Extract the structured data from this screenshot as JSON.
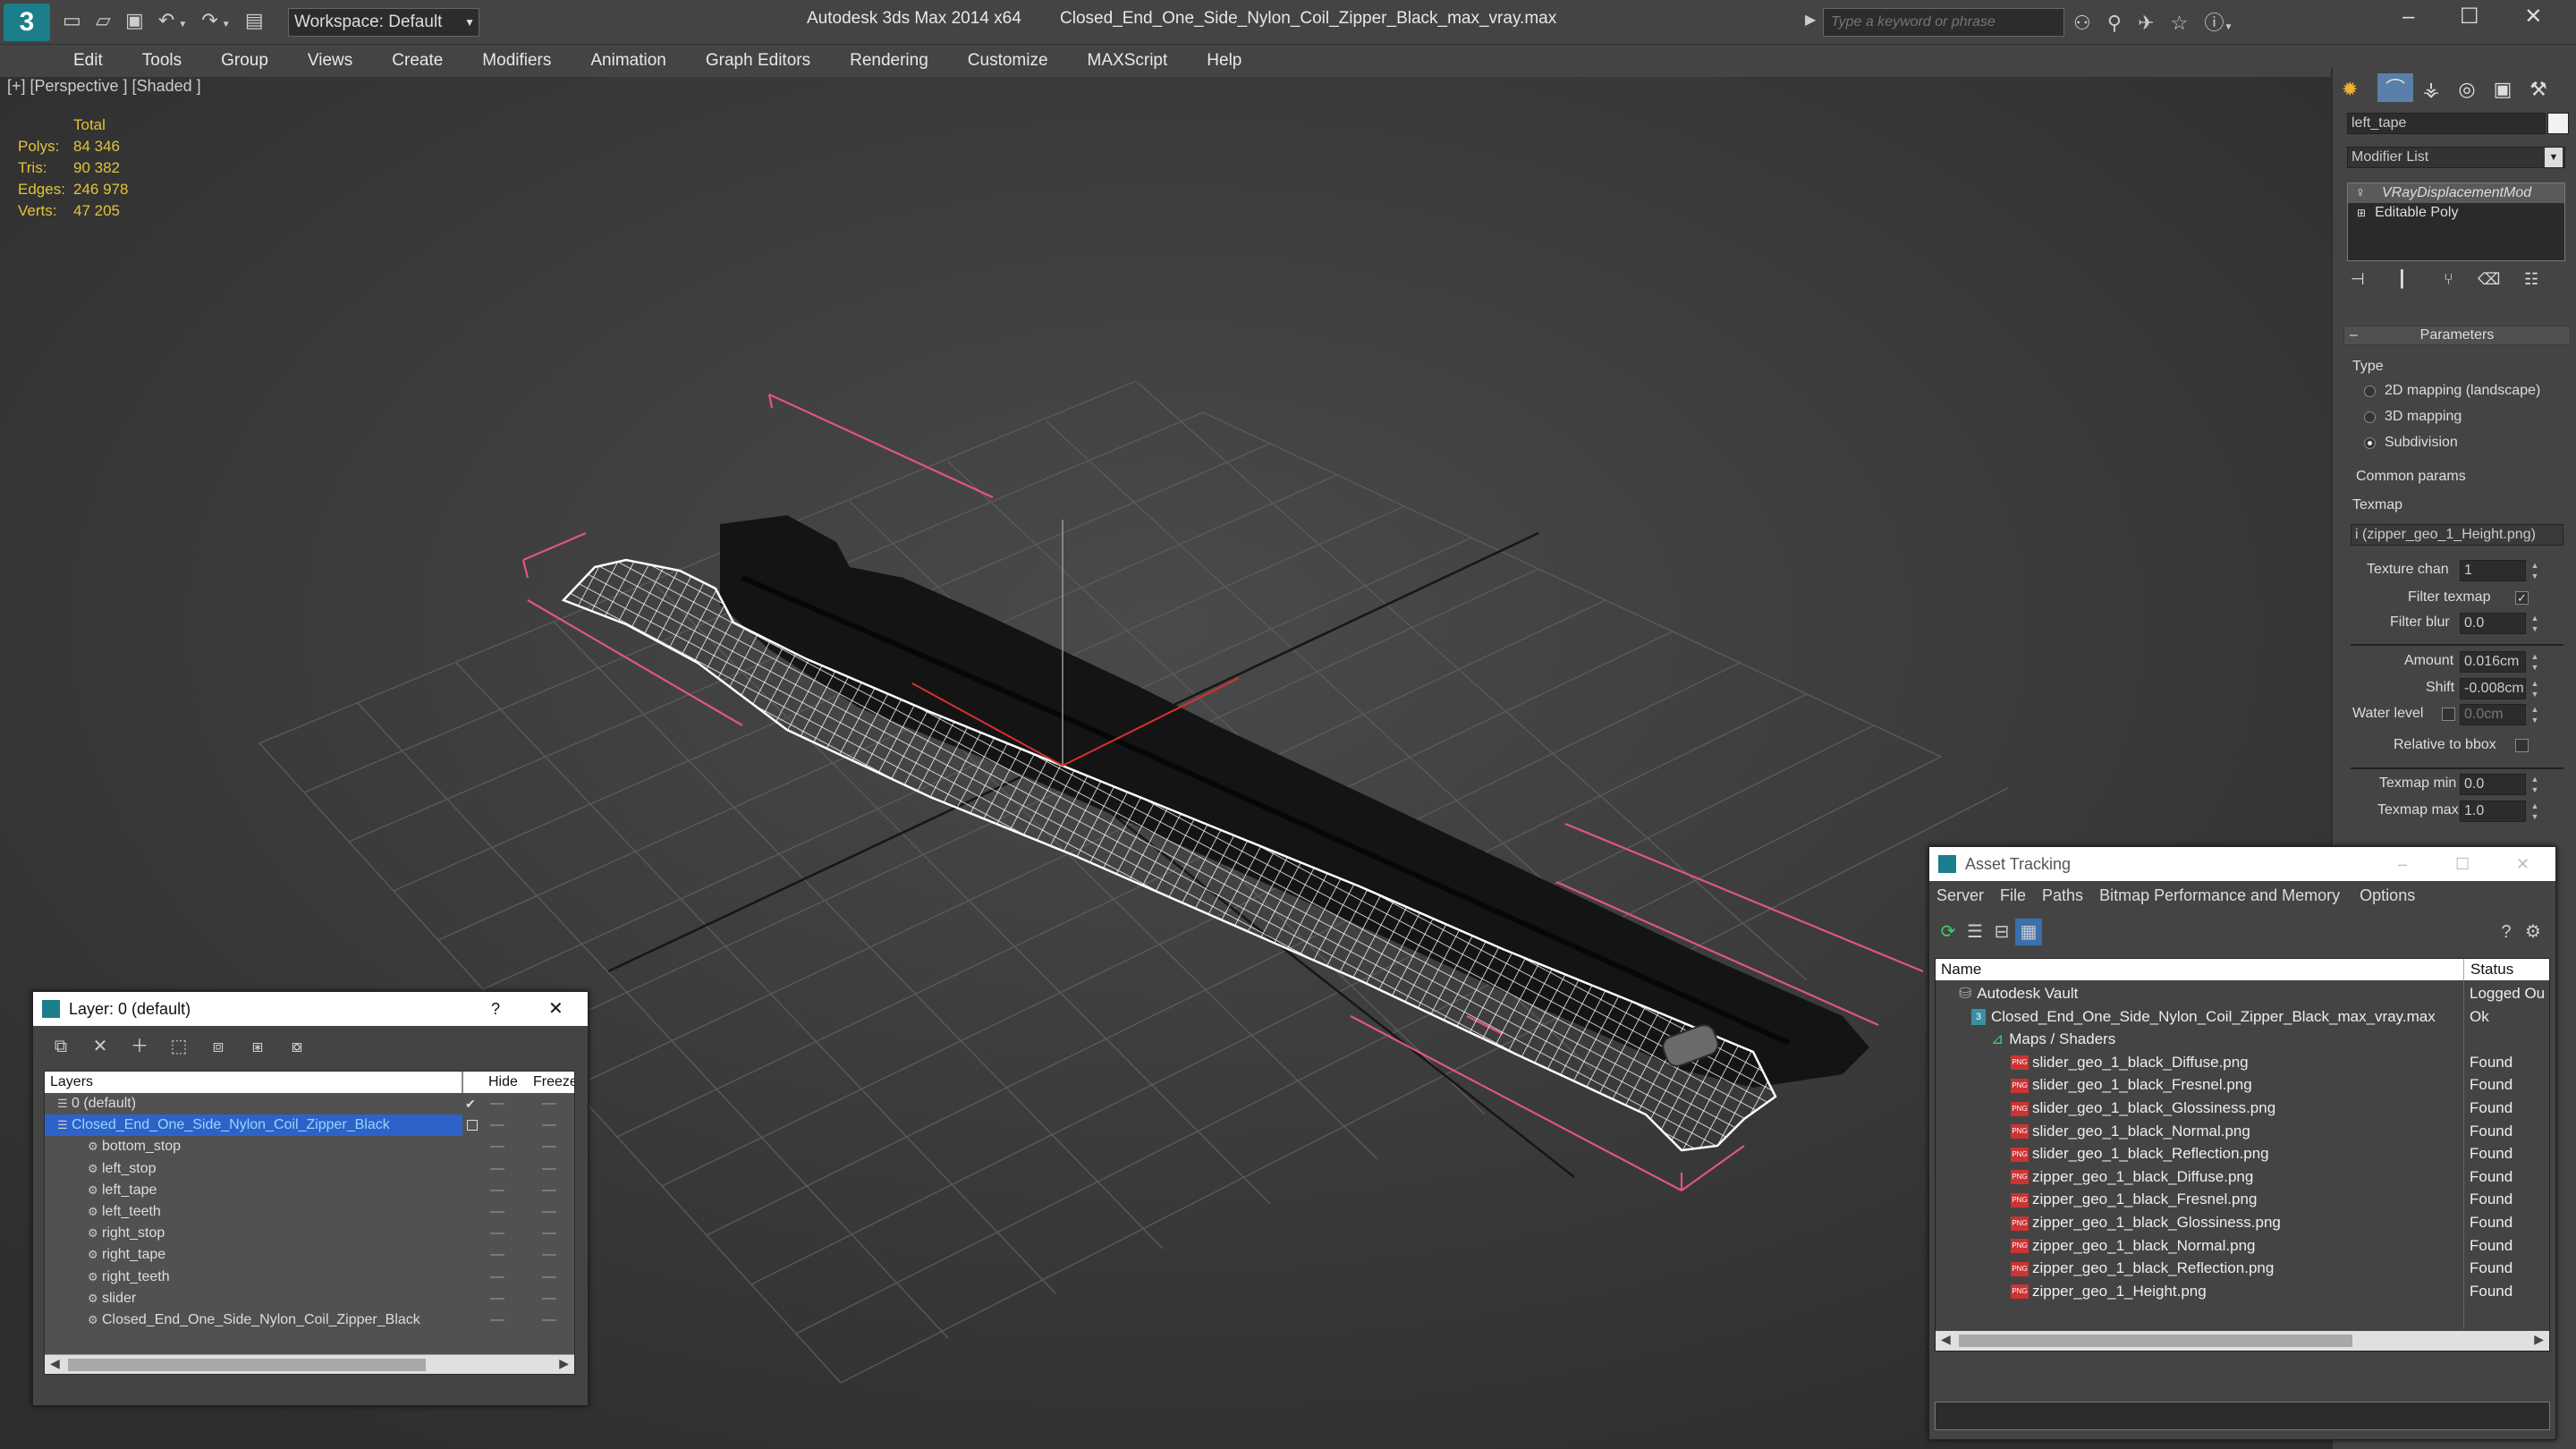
{
  "titlebar": {
    "workspace": "Workspace: Default",
    "app_title": "Autodesk 3ds Max  2014 x64",
    "file_title": "Closed_End_One_Side_Nylon_Coil_Zipper_Black_max_vray.max",
    "search_placeholder": "Type a keyword or phrase"
  },
  "menu": [
    "Edit",
    "Tools",
    "Group",
    "Views",
    "Create",
    "Modifiers",
    "Animation",
    "Graph Editors",
    "Rendering",
    "Customize",
    "MAXScript",
    "Help"
  ],
  "viewport": {
    "label": "[+] [Perspective ] [Shaded ]",
    "stats": {
      "header": "Total",
      "rows": [
        {
          "label": "Polys:",
          "value": "84 346"
        },
        {
          "label": "Tris:",
          "value": "90 382"
        },
        {
          "label": "Edges:",
          "value": "246 978"
        },
        {
          "label": "Verts:",
          "value": "47 205"
        }
      ]
    }
  },
  "command_panel": {
    "object_name": "left_tape",
    "modifier_list": "Modifier List",
    "stack": [
      "VRayDisplacementMod",
      "Editable Poly"
    ],
    "rollout_title": "Parameters",
    "type_label": "Type",
    "type_options": [
      {
        "label": "2D mapping (landscape)",
        "selected": false
      },
      {
        "label": "3D mapping",
        "selected": false
      },
      {
        "label": "Subdivision",
        "selected": true
      }
    ],
    "common_label": "Common params",
    "texmap_label": "Texmap",
    "texmap_value": "i (zipper_geo_1_Height.png)",
    "texture_chan_label": "Texture chan",
    "texture_chan_value": "1",
    "filter_texmap_label": "Filter texmap",
    "filter_blur_label": "Filter blur",
    "filter_blur_value": "0.0",
    "amount_label": "Amount",
    "amount_value": "0.016cm",
    "shift_label": "Shift",
    "shift_value": "-0.008cm",
    "water_label": "Water level",
    "water_value": "0.0cm",
    "relative_label": "Relative to bbox",
    "texmap_min_label": "Texmap min",
    "texmap_min_value": "0.0",
    "texmap_max_label": "Texmap max",
    "texmap_max_value": "1.0"
  },
  "layer_window": {
    "title": "Layer: 0 (default)",
    "help": "?",
    "columns": {
      "layers": "Layers",
      "hide": "Hide",
      "freeze": "Freeze"
    },
    "rows": [
      {
        "label": "0 (default)",
        "check": "✔"
      },
      {
        "label": "Closed_End_One_Side_Nylon_Coil_Zipper_Black"
      },
      {
        "label": "bottom_stop"
      },
      {
        "label": "left_stop"
      },
      {
        "label": "left_tape"
      },
      {
        "label": "left_teeth"
      },
      {
        "label": "right_stop"
      },
      {
        "label": "right_tape"
      },
      {
        "label": "right_teeth"
      },
      {
        "label": "slider"
      },
      {
        "label": "Closed_End_One_Side_Nylon_Coil_Zipper_Black"
      }
    ]
  },
  "asset_window": {
    "title": "Asset Tracking",
    "menu": [
      "Server",
      "File",
      "Paths",
      "Bitmap Performance and Memory",
      "Options"
    ],
    "columns": {
      "name": "Name",
      "status": "Status"
    },
    "rows": [
      {
        "name": "Autodesk Vault",
        "status": "Logged Ou"
      },
      {
        "name": "Closed_End_One_Side_Nylon_Coil_Zipper_Black_max_vray.max",
        "status": "Ok"
      },
      {
        "name": "Maps / Shaders",
        "status": ""
      },
      {
        "name": "slider_geo_1_black_Diffuse.png",
        "status": "Found"
      },
      {
        "name": "slider_geo_1_black_Fresnel.png",
        "status": "Found"
      },
      {
        "name": "slider_geo_1_black_Glossiness.png",
        "status": "Found"
      },
      {
        "name": "slider_geo_1_black_Normal.png",
        "status": "Found"
      },
      {
        "name": "slider_geo_1_black_Reflection.png",
        "status": "Found"
      },
      {
        "name": "zipper_geo_1_black_Diffuse.png",
        "status": "Found"
      },
      {
        "name": "zipper_geo_1_black_Fresnel.png",
        "status": "Found"
      },
      {
        "name": "zipper_geo_1_black_Glossiness.png",
        "status": "Found"
      },
      {
        "name": "zipper_geo_1_black_Normal.png",
        "status": "Found"
      },
      {
        "name": "zipper_geo_1_black_Reflection.png",
        "status": "Found"
      },
      {
        "name": "zipper_geo_1_Height.png",
        "status": "Found"
      }
    ],
    "png_badge": "PNG"
  }
}
